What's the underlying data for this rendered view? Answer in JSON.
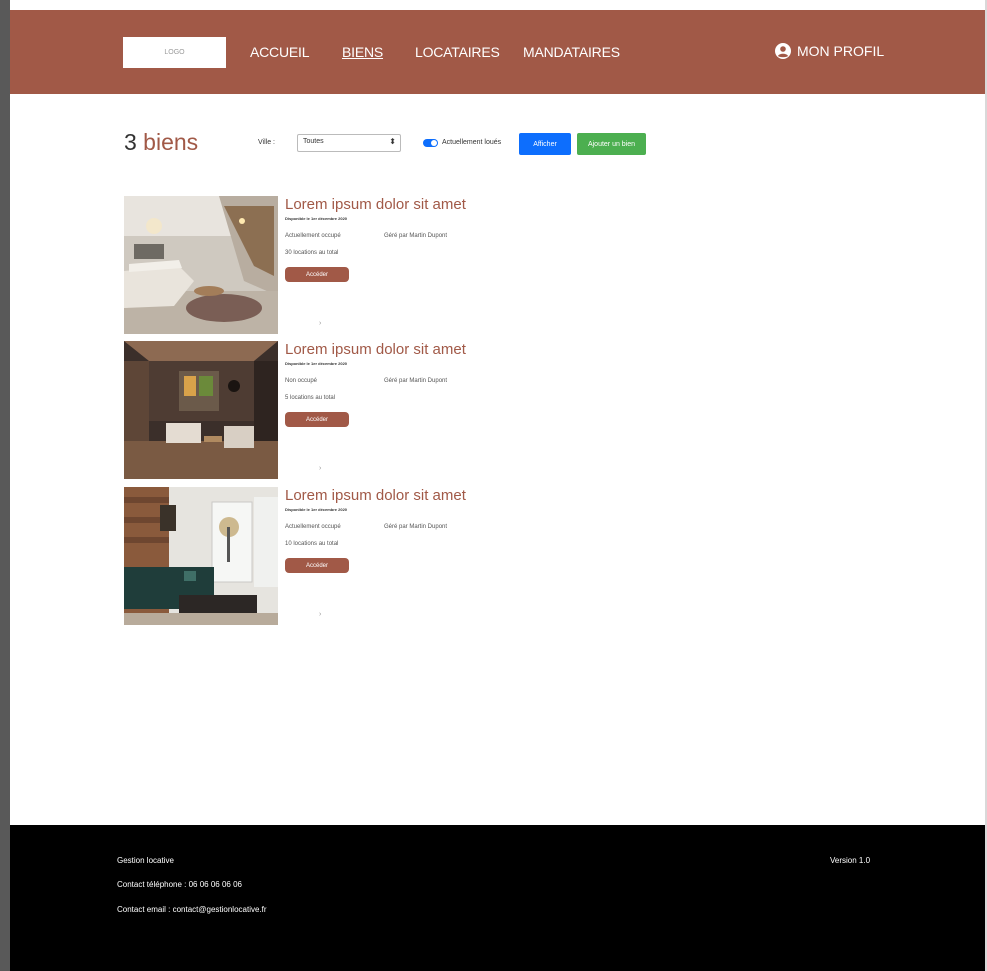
{
  "header": {
    "logo": "LOGO",
    "nav": [
      {
        "label": "ACCUEIL"
      },
      {
        "label": "BIENS"
      },
      {
        "label": "LOCATAIRES"
      },
      {
        "label": "MANDATAIRES"
      }
    ],
    "profile_label": "MON PROFIL"
  },
  "filters": {
    "count_number": "3",
    "count_label": " biens",
    "ville_label": "Ville :",
    "ville_selected": "Toutes",
    "toggle_label": "Actuellement loués",
    "show_button": "Afficher",
    "add_button": "Ajouter un bien"
  },
  "properties": [
    {
      "title": "Lorem ipsum dolor sit amet",
      "available": "Disponible le 1er décembre 2020",
      "status": "Actuellement occupé",
      "manager": "Géré par Martin Dupont",
      "rentals": "30 locations au total",
      "button": "Accéder",
      "chevron": "›"
    },
    {
      "title": "Lorem ipsum dolor sit amet",
      "available": "Disponible le 1er décembre 2020",
      "status": "Non occupé",
      "manager": "Géré par Martin Dupont",
      "rentals": "5 locations au total",
      "button": "Accéder",
      "chevron": "›"
    },
    {
      "title": "Lorem ipsum dolor sit amet",
      "available": "Disponible le 1er décembre 2020",
      "status": "Actuellement occupé",
      "manager": "Géré par Martin Dupont",
      "rentals": "10 locations au total",
      "button": "Accéder",
      "chevron": "›"
    }
  ],
  "footer": {
    "company": "Gestion locative",
    "phone": "Contact téléphone : 06 06 06 06 06",
    "email": "Contact email : contact@gestionlocative.fr",
    "version": "Version 1.0"
  },
  "colors": {
    "brand": "#a15947",
    "primary_button": "#0d6efd",
    "success_button": "#4caf50",
    "footer_bg": "#000000"
  }
}
